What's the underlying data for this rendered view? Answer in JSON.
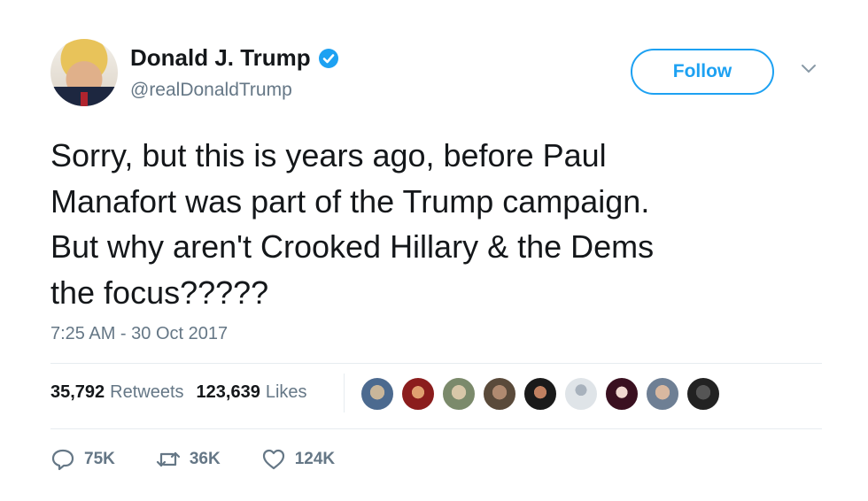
{
  "author": {
    "name": "Donald J. Trump",
    "handle": "@realDonaldTrump",
    "verified": true,
    "avatar_icon": "profile-photo"
  },
  "follow_button": {
    "label": "Follow"
  },
  "tweet": {
    "lines": [
      "Sorry, but this is years ago, before Paul",
      "Manafort was part of the Trump campaign.",
      "But why aren't Crooked Hillary & the Dems",
      "the focus?????"
    ],
    "timestamp": "7:25 AM - 30 Oct 2017"
  },
  "stats": {
    "retweets_count": "35,792",
    "retweets_label": "Retweets",
    "likes_count": "123,639",
    "likes_label": "Likes"
  },
  "actions": {
    "reply_count": "75K",
    "retweet_count": "36K",
    "like_count": "124K"
  },
  "colors": {
    "accent": "#1da1f2",
    "text": "#14171a",
    "secondary": "#657786",
    "divider": "#e6ecf0"
  }
}
